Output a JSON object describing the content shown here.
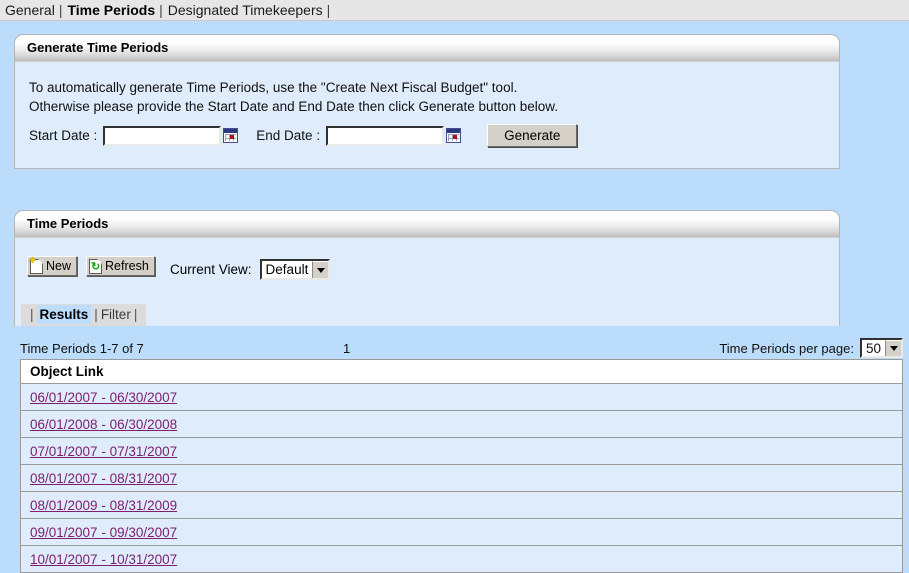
{
  "tabbar": {
    "tabs": [
      {
        "label": "General",
        "active": false
      },
      {
        "label": "Time Periods",
        "active": true
      },
      {
        "label": "Designated Timekeepers",
        "active": false
      }
    ],
    "separator": "|"
  },
  "generate_panel": {
    "title": "Generate Time Periods",
    "instruction_line1": "To automatically generate Time Periods, use the \"Create Next Fiscal Budget\" tool.",
    "instruction_line2": "Otherwise please provide the Start Date and End Date then click Generate button below.",
    "start_date_label": "Start Date :",
    "start_date_value": "",
    "start_date_placeholder": "",
    "end_date_label": "End Date :",
    "end_date_value": "",
    "end_date_placeholder": "",
    "calendar_icon": "calendar-icon",
    "generate_button": "Generate"
  },
  "time_periods_panel": {
    "title": "Time Periods",
    "toolbar": {
      "new_label": "New",
      "new_icon": "new-document-icon",
      "refresh_label": "Refresh",
      "refresh_icon": "refresh-icon"
    },
    "current_view_label": "Current View:",
    "current_view_value": "Default",
    "subtabs": {
      "separator": "|",
      "items": [
        {
          "label": "Results",
          "active": true
        },
        {
          "label": "Filter",
          "active": false
        }
      ]
    }
  },
  "results": {
    "count_text": "Time Periods 1-7 of 7",
    "current_page": "1",
    "per_page_label": "Time Periods per page:",
    "per_page_value": "50",
    "column_header": "Object Link",
    "rows": [
      {
        "label": "06/01/2007 - 06/30/2007"
      },
      {
        "label": "06/01/2008 - 06/30/2008"
      },
      {
        "label": "07/01/2007 - 07/31/2007"
      },
      {
        "label": "08/01/2007 - 08/31/2007"
      },
      {
        "label": "08/01/2009 - 08/31/2009"
      },
      {
        "label": "09/01/2007 - 09/30/2007"
      },
      {
        "label": "10/01/2007 - 10/31/2007"
      }
    ]
  },
  "colors": {
    "page_background": "#bcdcfb",
    "panel_body": "#dfecfb",
    "tabbar_background": "#e6e6e6",
    "link": "#7c1f6e",
    "button_face": "#d4d0c8"
  }
}
